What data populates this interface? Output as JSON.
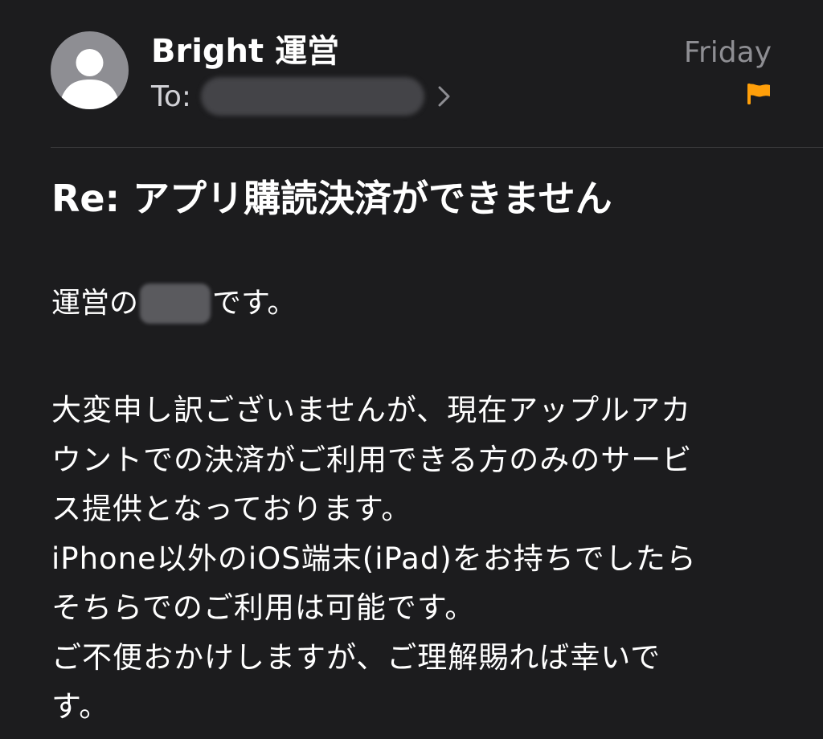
{
  "header": {
    "sender": "Bright 運営",
    "to_label": "To:",
    "date": "Friday",
    "flag_color": "#ff9f0a"
  },
  "subject": "Re: アプリ購読決済ができません",
  "body": {
    "greeting_prefix": "運営の",
    "greeting_suffix": "です。",
    "lines": [
      "大変申し訳ございませんが、現在アップルアカ",
      "ウントでの決済がご利用できる方のみのサービ",
      "ス提供となっております。",
      "iPhone以外のiOS端末(iPad)をお持ちでしたら",
      "そちらでのご利用は可能です。",
      "ご不便おかけしますが、ご理解賜れば幸いで",
      "す。"
    ]
  },
  "icons": {
    "avatar": "person-icon",
    "chevron": "chevron-right-icon",
    "flag": "flag-icon"
  }
}
